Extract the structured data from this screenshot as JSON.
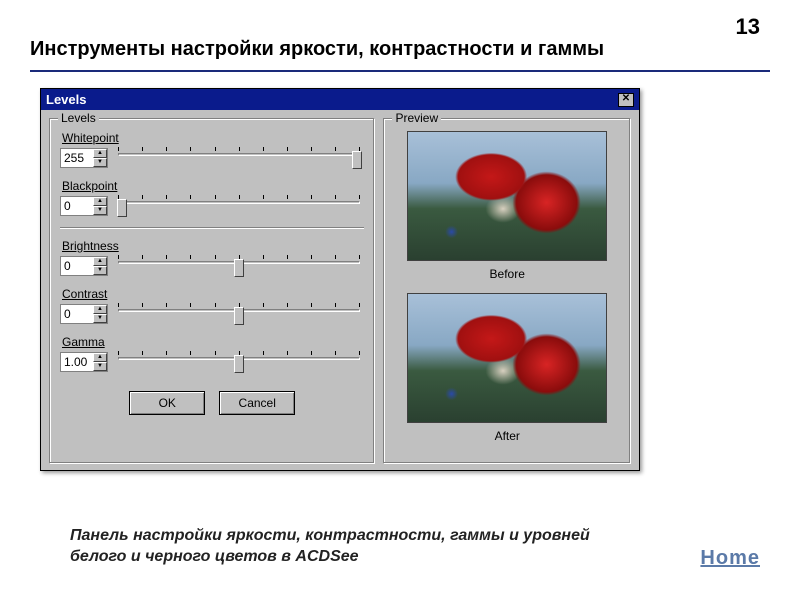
{
  "page": {
    "number": "13",
    "title": "Инструменты настройки яркости, контрастности и гаммы",
    "caption": "Панель настройки яркости, контрастности, гаммы и уровней белого и черного цветов в ACDSee",
    "home_link": "Home"
  },
  "dialog": {
    "title": "Levels",
    "close_glyph": "✕",
    "levels_group_label": "Levels",
    "preview_group_label": "Preview",
    "before_label": "Before",
    "after_label": "After",
    "ok_label": "OK",
    "cancel_label": "Cancel",
    "sliders": {
      "whitepoint": {
        "label": "Whitepoint",
        "value": "255",
        "thumb_pct": 97
      },
      "blackpoint": {
        "label": "Blackpoint",
        "value": "0",
        "thumb_pct": 3
      },
      "brightness": {
        "label": "Brightness",
        "value": "0",
        "thumb_pct": 50
      },
      "contrast": {
        "label": "Contrast",
        "value": "0",
        "thumb_pct": 50
      },
      "gamma": {
        "label": "Gamma",
        "value": "1.00",
        "thumb_pct": 50
      }
    }
  }
}
